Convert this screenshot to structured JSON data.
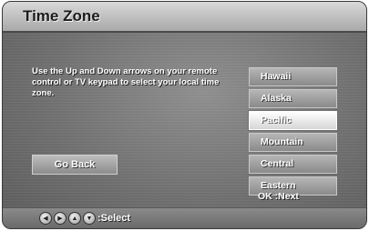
{
  "title": "Time Zone",
  "instructions": "Use the Up and Down arrows on your remote control or TV keypad to select your local time zone.",
  "go_back_label": "Go Back",
  "time_zones": [
    "Hawaii",
    "Alaska",
    "Pacific",
    "Mountain",
    "Central",
    "Eastern"
  ],
  "selected_time_zone": "Pacific",
  "ok_hint": "OK :Next",
  "footer": {
    "select_label": ":Select",
    "nav_icons": [
      "arrow-left-icon",
      "arrow-right-icon",
      "arrow-up-icon",
      "arrow-down-icon"
    ]
  }
}
